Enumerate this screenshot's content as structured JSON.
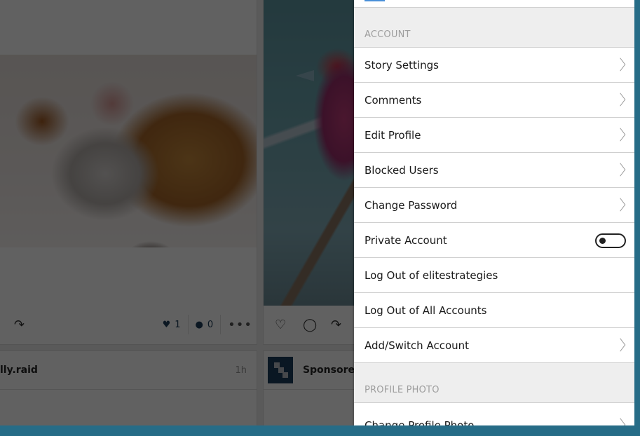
{
  "feed": {
    "post1": {
      "photo_alt": "Sleeping kitten and puppy",
      "likes": "1",
      "comments": "0",
      "icons": {
        "share": "share-arrow-icon",
        "likes": "heart-filled-icon",
        "comments": "comment-filled-icon",
        "more": "more-dots-icon"
      }
    },
    "post2": {
      "photo_alt": "Red bird on branches",
      "icons": {
        "like": "heart-outline-icon",
        "comment": "comment-outline-icon",
        "share": "share-arrow-icon"
      }
    },
    "post3": {
      "username": "lly.raid",
      "time": "1h"
    },
    "post4": {
      "username": "Sponsored"
    }
  },
  "settings": {
    "account_section": {
      "title": "ACCOUNT",
      "items": [
        {
          "label": "Story Settings",
          "type": "link"
        },
        {
          "label": "Comments",
          "type": "link"
        },
        {
          "label": "Edit Profile",
          "type": "link"
        },
        {
          "label": "Blocked Users",
          "type": "link"
        },
        {
          "label": "Change Password",
          "type": "link"
        },
        {
          "label": "Private Account",
          "type": "toggle",
          "value": false
        },
        {
          "label": "Log Out of elitestrategies",
          "type": "action"
        },
        {
          "label": "Log Out of All Accounts",
          "type": "action"
        },
        {
          "label": "Add/Switch Account",
          "type": "link"
        }
      ]
    },
    "profile_photo_section": {
      "title": "PROFILE PHOTO",
      "items": [
        {
          "label": "Change Profile Photo",
          "type": "link"
        }
      ]
    }
  },
  "colors": {
    "desktop_bg": "#266c87",
    "accent": "#4a90d9",
    "section_bg": "#eeeeee",
    "section_text": "#9e9e9e",
    "stat_text": "#1e3d59"
  }
}
